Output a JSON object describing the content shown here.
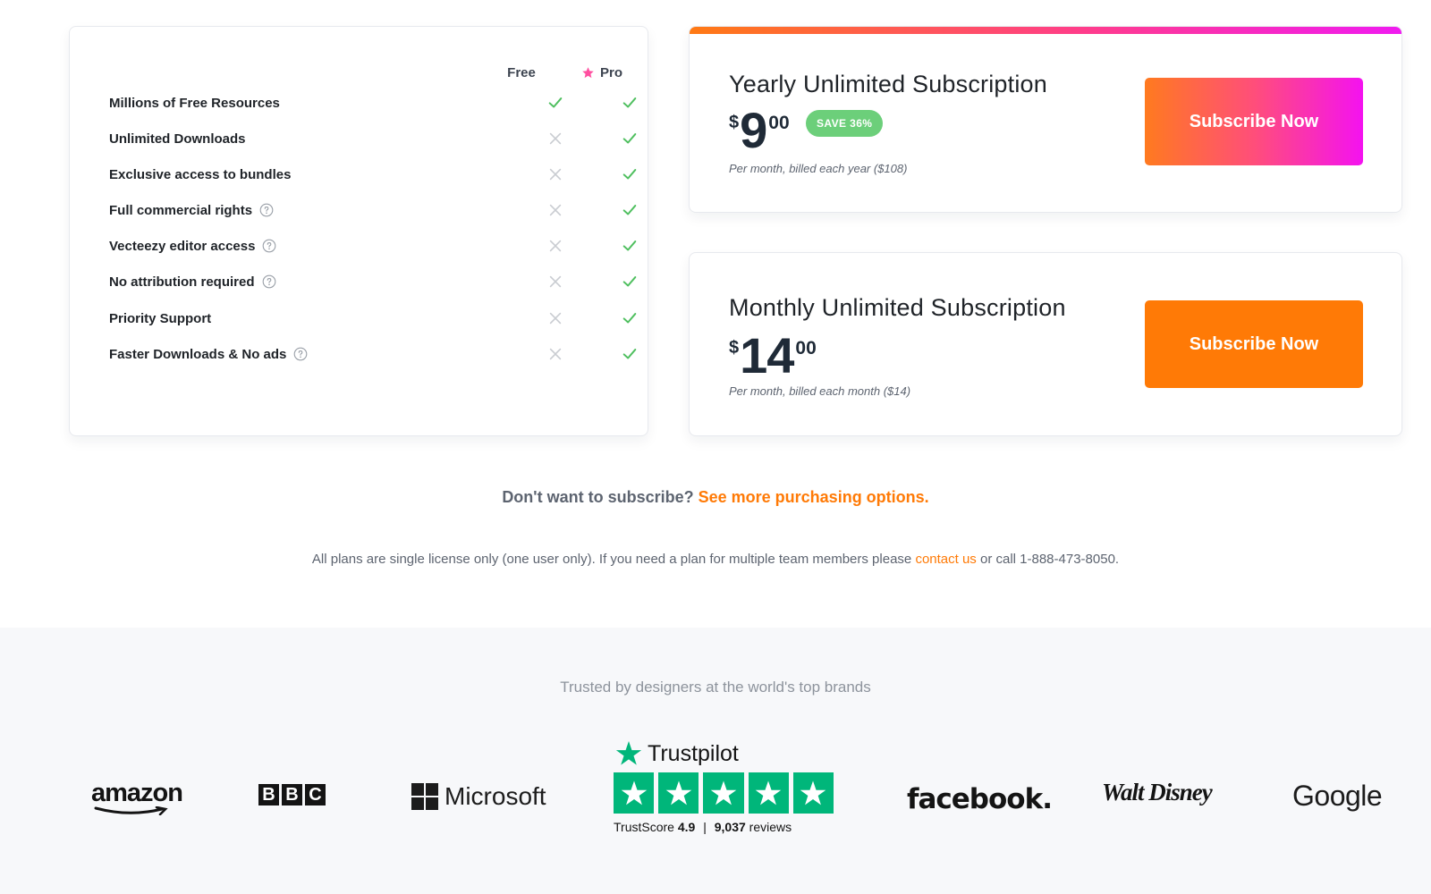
{
  "features": {
    "columns": {
      "free": "Free",
      "pro": "Pro"
    },
    "rows": [
      {
        "label": "Millions of Free Resources",
        "help": false,
        "free": true,
        "pro": true
      },
      {
        "label": "Unlimited Downloads",
        "help": false,
        "free": false,
        "pro": true
      },
      {
        "label": "Exclusive access to bundles",
        "help": false,
        "free": false,
        "pro": true
      },
      {
        "label": "Full commercial rights",
        "help": true,
        "free": false,
        "pro": true
      },
      {
        "label": "Vecteezy editor access",
        "help": true,
        "free": false,
        "pro": true
      },
      {
        "label": "No attribution required",
        "help": true,
        "free": false,
        "pro": true
      },
      {
        "label": "Priority Support",
        "help": false,
        "free": false,
        "pro": true
      },
      {
        "label": "Faster Downloads & No ads",
        "help": true,
        "free": false,
        "pro": true
      }
    ],
    "check_color": "#4fbf5f",
    "cross_color": "#c9ccd1",
    "pro_star_color": "#ff4fa0"
  },
  "plans": {
    "yearly": {
      "title": "Yearly Unlimited Subscription",
      "currency": "$",
      "whole": "9",
      "cents": "00",
      "badge": "SAVE 36%",
      "note": "Per month, billed each year ($108)",
      "button": "Subscribe Now"
    },
    "monthly": {
      "title": "Monthly Unlimited Subscription",
      "currency": "$",
      "whole": "14",
      "cents": "00",
      "note": "Per month, billed each month ($14)",
      "button": "Subscribe Now"
    }
  },
  "purchase": {
    "question": "Don't want to subscribe?",
    "link": "See more purchasing options."
  },
  "license": {
    "before": "All plans are single license only (one user only). If you need a plan for multiple team members please",
    "link": "contact us",
    "after": "or call 1-888-473-8050."
  },
  "brands": {
    "heading": "Trusted by designers at the world's top brands",
    "amazon": "amazon",
    "bbc": [
      "B",
      "B",
      "C"
    ],
    "microsoft": "Microsoft",
    "facebook": "facebook.",
    "disney": "Walt Disney",
    "google": "Google"
  },
  "trustpilot": {
    "name": "Trustpilot",
    "score_label": "TrustScore",
    "score": "4.9",
    "separator": "|",
    "reviews_count": "9,037",
    "reviews_label": "reviews",
    "stars": 5,
    "color": "#00b67a"
  },
  "accent": "#ff7a06"
}
